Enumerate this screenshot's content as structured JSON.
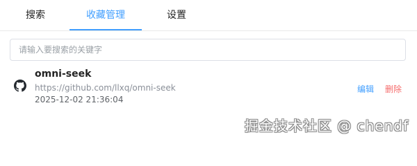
{
  "tabs": [
    {
      "label": "搜索",
      "active": false
    },
    {
      "label": "收藏管理",
      "active": true
    },
    {
      "label": "设置",
      "active": false
    }
  ],
  "search": {
    "placeholder": "请输入要搜索的关键字",
    "value": ""
  },
  "bookmarks": [
    {
      "icon": "github-icon",
      "title": "omni-seek",
      "url": "https://github.com/llxq/omni-seek",
      "created": "2025-12-02 21:36:04",
      "edit_label": "编辑",
      "delete_label": "删除"
    }
  ],
  "watermark": "掘金技术社区 @ chendf",
  "colors": {
    "accent": "#409eff",
    "danger": "#f56c6c",
    "text": "#222222",
    "muted": "#8a8f98",
    "border": "#dcdfe6"
  }
}
